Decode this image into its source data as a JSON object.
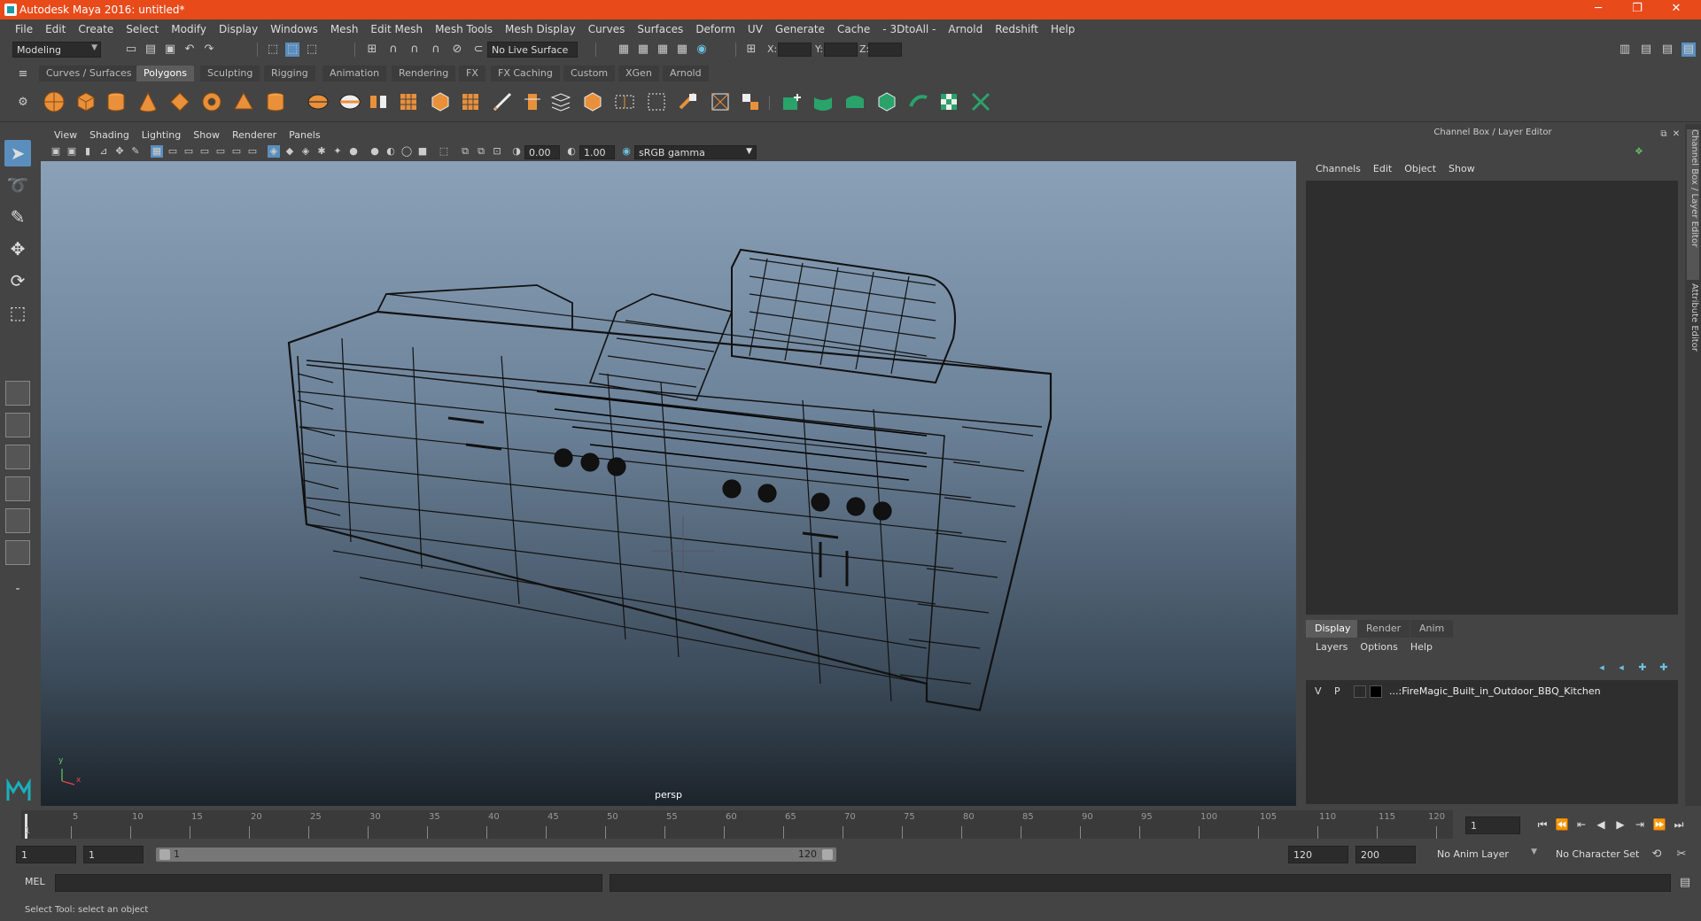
{
  "window": {
    "title": "Autodesk Maya 2016: untitled*",
    "minimize": "─",
    "restore": "❐",
    "close": "✕"
  },
  "menubar": [
    "File",
    "Edit",
    "Create",
    "Select",
    "Modify",
    "Display",
    "Windows",
    "Mesh",
    "Edit Mesh",
    "Mesh Tools",
    "Mesh Display",
    "Curves",
    "Surfaces",
    "Deform",
    "UV",
    "Generate",
    "Cache",
    "- 3DtoAll -",
    "Arnold",
    "Redshift",
    "Help"
  ],
  "statusline": {
    "mode": "Modeling",
    "live_surface": "No Live Surface",
    "x_label": "X:",
    "y_label": "Y:",
    "z_label": "Z:"
  },
  "shelf_tabs": [
    {
      "label": "Curves / Surfaces",
      "active": false
    },
    {
      "label": "Polygons",
      "active": true
    },
    {
      "label": "Sculpting",
      "active": false
    },
    {
      "label": "Rigging",
      "active": false
    },
    {
      "label": "Animation",
      "active": false
    },
    {
      "label": "Rendering",
      "active": false
    },
    {
      "label": "FX",
      "active": false
    },
    {
      "label": "FX Caching",
      "active": false
    },
    {
      "label": "Custom",
      "active": false
    },
    {
      "label": "XGen",
      "active": false
    },
    {
      "label": "Arnold",
      "active": false
    }
  ],
  "viewport": {
    "menu": [
      "View",
      "Shading",
      "Lighting",
      "Show",
      "Renderer",
      "Panels"
    ],
    "exposure": "0.00",
    "gamma": "1.00",
    "color_space": "sRGB gamma",
    "camera": "persp",
    "axis_y": "y",
    "axis_x": "x"
  },
  "channel_box": {
    "title": "Channel Box / Layer Editor",
    "menu": [
      "Channels",
      "Edit",
      "Object",
      "Show"
    ]
  },
  "layer_editor": {
    "tabs": [
      {
        "label": "Display",
        "active": true
      },
      {
        "label": "Render",
        "active": false
      },
      {
        "label": "Anim",
        "active": false
      }
    ],
    "menu": [
      "Layers",
      "Options",
      "Help"
    ],
    "layers": [
      {
        "v": "V",
        "p": "P",
        "name": "...:FireMagic_Built_in_Outdoor_BBQ_Kitchen"
      }
    ]
  },
  "side_tabs": [
    "Channel Box / Layer Editor",
    "Attribute Editor"
  ],
  "timeline": {
    "ticks": [
      "5",
      "10",
      "15",
      "20",
      "25",
      "30",
      "35",
      "40",
      "45",
      "50",
      "55",
      "60",
      "65",
      "70",
      "75",
      "80",
      "85",
      "90",
      "95",
      "100",
      "105",
      "110",
      "115",
      "120"
    ],
    "start_label": "1",
    "current_frame": "1"
  },
  "range": {
    "start": "1",
    "playback_start": "1",
    "range_start": "1",
    "range_end": "120",
    "playback_end": "120",
    "end": "200",
    "anim_layer": "No Anim Layer",
    "char_set": "No Character Set"
  },
  "command": {
    "label": "MEL"
  },
  "help_line": "Select Tool: select an object"
}
